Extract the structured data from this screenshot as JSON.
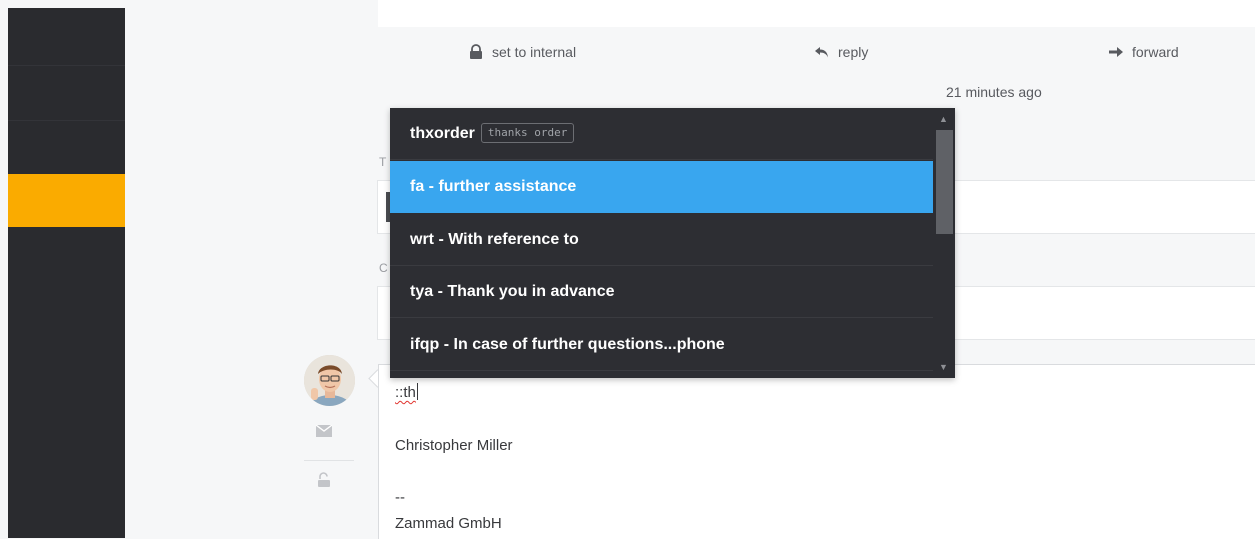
{
  "colors": {
    "nav_background": "#2a2b2f",
    "nav_active": "#faab00",
    "dropdown_background": "#2d2e33",
    "dropdown_selected": "#39a6ef"
  },
  "article_actions": {
    "internal_label": "set to internal",
    "internal_icon": "lock-icon",
    "reply_label": "reply",
    "reply_icon": "reply-arrow-icon",
    "forward_label": "forward",
    "forward_icon": "forward-arrow-icon"
  },
  "article_timestamp": "21 minutes ago",
  "text_modules": {
    "items": [
      {
        "label": "thxorder",
        "keyword": "thanks order"
      },
      {
        "label": "fa - further assistance",
        "keyword": ""
      },
      {
        "label": "wrt - With reference to",
        "keyword": ""
      },
      {
        "label": "tya - Thank you in advance",
        "keyword": ""
      },
      {
        "label": "ifqp - In case of further questions...phone",
        "keyword": ""
      }
    ],
    "selected_index": 1
  },
  "composer": {
    "typed_text": "::th",
    "signature_name": "Christopher Miller",
    "signature_separator": "--",
    "signature_company": "Zammad GmbH",
    "channel_icon": "envelope-icon",
    "visibility_icon": "unlock-icon"
  },
  "hidden_labels": {
    "to_label_fragment": "T",
    "cc_label_fragment": "C"
  }
}
